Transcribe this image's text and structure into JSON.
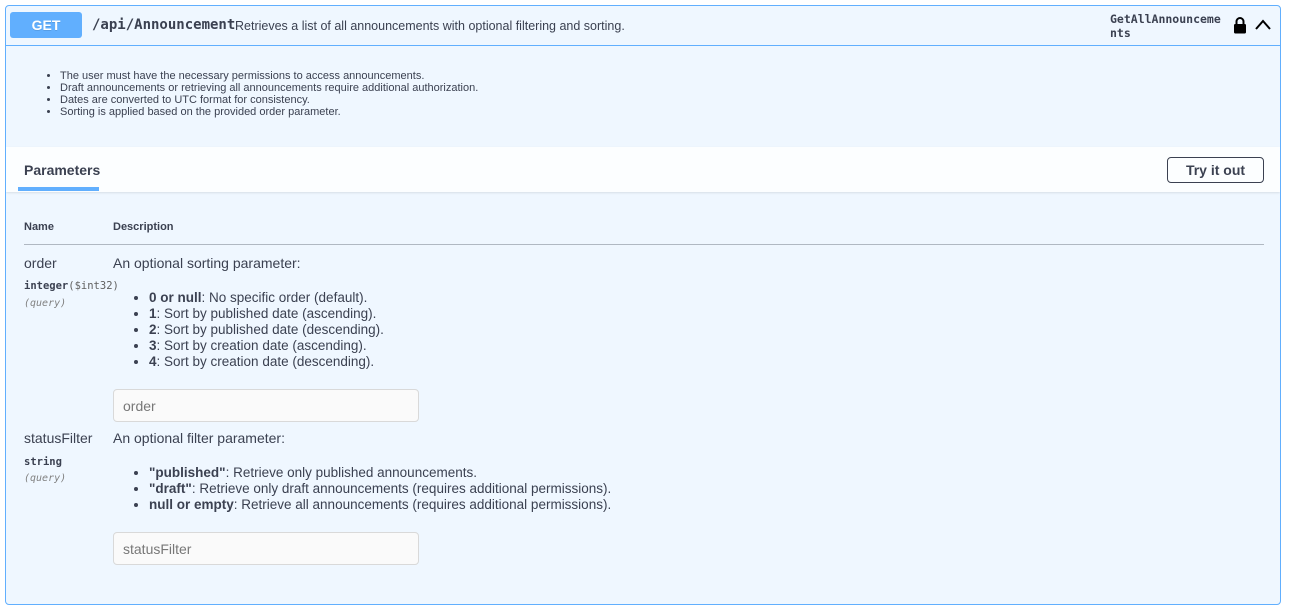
{
  "summary": {
    "method": "GET",
    "path": "/api/Announcement",
    "description": "Retrieves a list of all announcements with optional filtering and sorting.",
    "operation_id": "GetAllAnnouncements",
    "lock_icon": "lock-icon",
    "chevron_icon": "chevron-up-icon"
  },
  "notes": [
    "The user must have the necessary permissions to access announcements.",
    "Draft announcements or retrieving all announcements require additional authorization.",
    "Dates are converted to UTC format for consistency.",
    "Sorting is applied based on the provided order parameter."
  ],
  "parameters_tab": {
    "label": "Parameters",
    "try_it_out": "Try it out"
  },
  "table": {
    "name_header": "Name",
    "description_header": "Description"
  },
  "params": [
    {
      "name": "order",
      "type": "integer",
      "format": "($int32)",
      "in": "(query)",
      "description": "An optional sorting parameter:",
      "options": [
        {
          "key": "0 or null",
          "text": ": No specific order (default)."
        },
        {
          "key": "1",
          "text": ": Sort by published date (ascending)."
        },
        {
          "key": "2",
          "text": ": Sort by published date (descending)."
        },
        {
          "key": "3",
          "text": ": Sort by creation date (ascending)."
        },
        {
          "key": "4",
          "text": ": Sort by creation date (descending)."
        }
      ],
      "placeholder": "order"
    },
    {
      "name": "statusFilter",
      "type": "string",
      "format": "",
      "in": "(query)",
      "description": "An optional filter parameter:",
      "options": [
        {
          "key": "\"published\"",
          "text": ": Retrieve only published announcements."
        },
        {
          "key": "\"draft\"",
          "text": ": Retrieve only draft announcements (requires additional permissions)."
        },
        {
          "key": "null or empty",
          "text": ": Retrieve all announcements (requires additional permissions)."
        }
      ],
      "placeholder": "statusFilter"
    }
  ]
}
